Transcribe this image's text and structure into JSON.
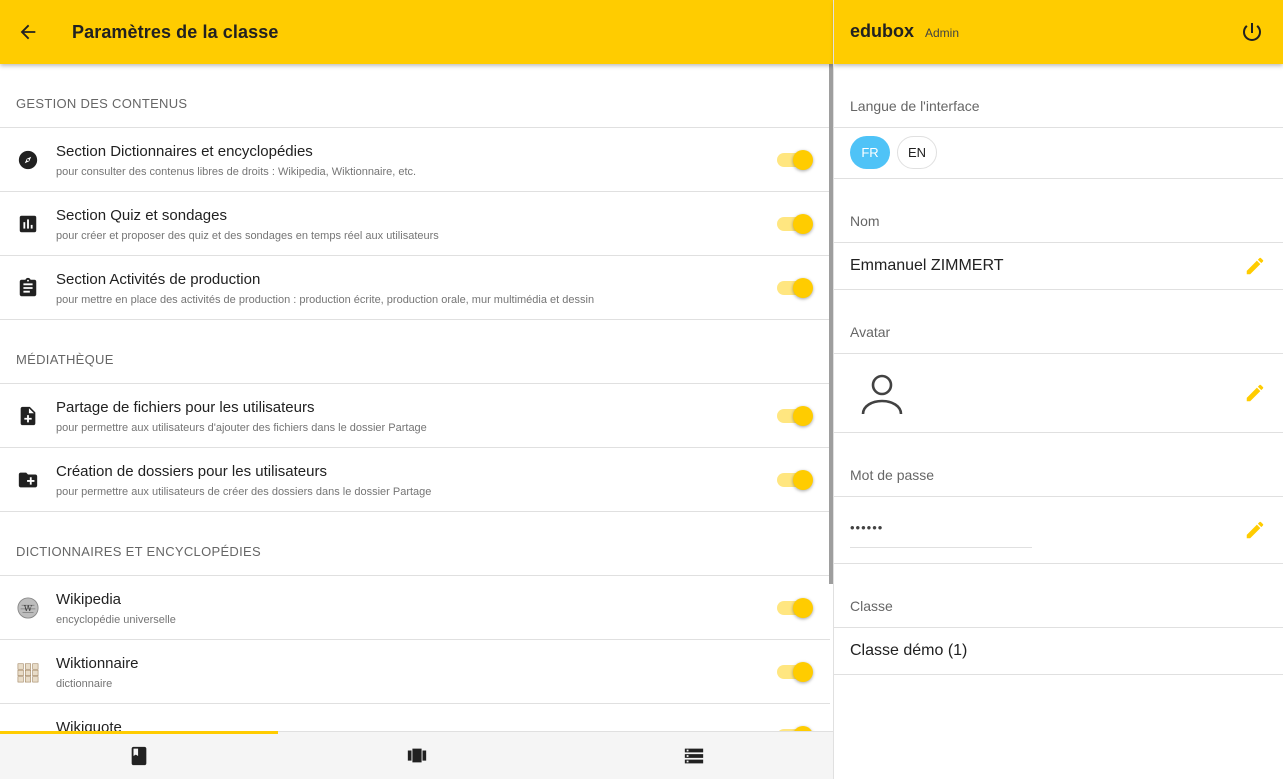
{
  "left_header": {
    "title": "Paramètres de la classe"
  },
  "sections": [
    {
      "title": "GESTION DES CONTENUS",
      "items": [
        {
          "icon": "compass-icon",
          "title": "Section Dictionnaires et encyclopédies",
          "subtitle": "pour consulter des contenus libres de droits : Wikipedia, Wiktionnaire, etc.",
          "enabled": true
        },
        {
          "icon": "poll-icon",
          "title": "Section Quiz et sondages",
          "subtitle": "pour créer et proposer des quiz et des sondages en temps réel aux utilisateurs",
          "enabled": true
        },
        {
          "icon": "clipboard-icon",
          "title": "Section Activités de production",
          "subtitle": "pour mettre en place des activités de production : production écrite, production orale, mur multimédia et dessin",
          "enabled": true
        }
      ]
    },
    {
      "title": "MÉDIATHÈQUE",
      "items": [
        {
          "icon": "file-add-icon",
          "title": "Partage de fichiers pour les utilisateurs",
          "subtitle": "pour permettre aux utilisateurs d'ajouter des fichiers dans le dossier Partage",
          "enabled": true
        },
        {
          "icon": "folder-add-icon",
          "title": "Création de dossiers pour les utilisateurs",
          "subtitle": "pour permettre aux utilisateurs de créer des dossiers dans le dossier Partage",
          "enabled": true
        }
      ]
    },
    {
      "title": "DICTIONNAIRES ET ENCYCLOPÉDIES",
      "items": [
        {
          "icon": "wikipedia-globe-icon",
          "title": "Wikipedia",
          "subtitle": "encyclopédie universelle",
          "enabled": true
        },
        {
          "icon": "wiktionary-logo-icon",
          "title": "Wiktionnaire",
          "subtitle": "dictionnaire",
          "enabled": true
        },
        {
          "icon": "wikiquote-logo-icon",
          "title": "Wikiquote",
          "subtitle": "",
          "enabled": true
        }
      ]
    }
  ],
  "bottom_nav": [
    {
      "name": "tab-book",
      "icon": "book-icon",
      "active": true
    },
    {
      "name": "tab-carousel",
      "icon": "view-carousel-icon",
      "active": false
    },
    {
      "name": "tab-storage",
      "icon": "storage-icon",
      "active": false
    }
  ],
  "right_header": {
    "brand": "edubox",
    "role": "Admin"
  },
  "profile": {
    "language_label": "Langue de l'interface",
    "languages": [
      "FR",
      "EN"
    ],
    "selected_language": "FR",
    "name_label": "Nom",
    "name_value": "Emmanuel ZIMMERT",
    "avatar_label": "Avatar",
    "password_label": "Mot de passe",
    "password_value": "••••••",
    "class_label": "Classe",
    "class_value": "Classe démo (1)"
  },
  "colors": {
    "accent": "#FFCC00",
    "chip_selected": "#4fc3f7"
  }
}
